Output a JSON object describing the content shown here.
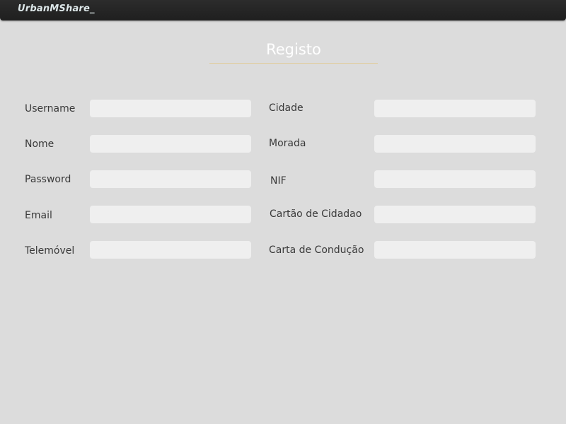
{
  "app": {
    "title": "UrbanMShare_"
  },
  "page": {
    "title": "Registo"
  },
  "form": {
    "left_fields": [
      {
        "label": "Username",
        "value": "",
        "placeholder": ""
      },
      {
        "label": "Nome",
        "value": "",
        "placeholder": ""
      },
      {
        "label": "Password",
        "value": "",
        "placeholder": ""
      },
      {
        "label": "Email",
        "value": "",
        "placeholder": ""
      },
      {
        "label": "Telemóvel",
        "value": "",
        "placeholder": ""
      }
    ],
    "right_fields": [
      {
        "label": "Cidade",
        "value": "",
        "placeholder": ""
      },
      {
        "label": "Morada",
        "value": "",
        "placeholder": ""
      },
      {
        "label": "NIF",
        "value": "",
        "placeholder": ""
      },
      {
        "label": "Cartão de Cidadao",
        "value": "",
        "placeholder": ""
      },
      {
        "label": "Carta de Condução",
        "value": "",
        "placeholder": ""
      }
    ]
  },
  "colors": {
    "background": "#dcdcdc",
    "titlebar": "#262626",
    "input": "#efefef",
    "accent_underline": "#e0cc9a",
    "title_text": "#ffffff"
  }
}
